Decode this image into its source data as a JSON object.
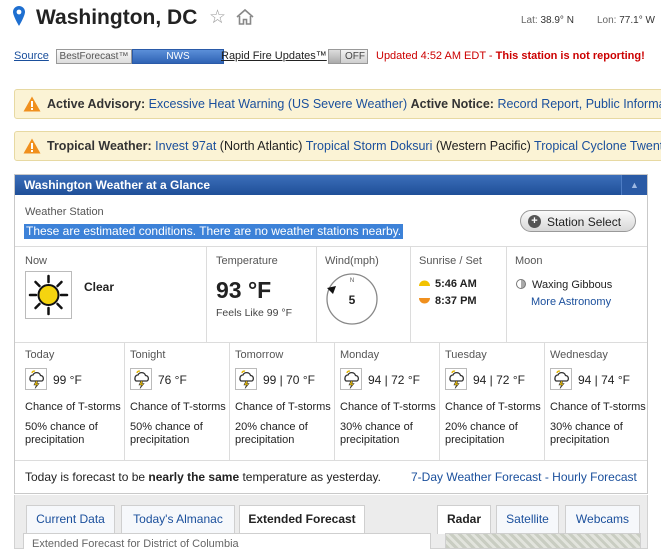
{
  "header": {
    "city": "Washington, DC",
    "lat_label": "Lat:",
    "lat_value": "38.9° N",
    "lon_label": "Lon:",
    "lon_value": "77.1° W"
  },
  "source": {
    "label": "Source",
    "option_best": "BestForecast™",
    "option_nws": "NWS",
    "rapid_fire_label": "Rapid Fire Updates™",
    "rapid_fire_state": "OFF",
    "updated_text": "Updated 4:52 AM EDT",
    "updated_sep": " - ",
    "warning_text": "This station is not reporting!"
  },
  "alerts": {
    "advisory_label": "Active Advisory:",
    "advisory_link": "Excessive Heat Warning (US Severe Weather)",
    "notice_label": "Active Notice:",
    "notice_link1": "Record Report,",
    "notice_link2": "Public Information",
    "tropical_label": "Tropical Weather:",
    "tropical_link1": "Invest 97at",
    "tropical_region1": "(North Atlantic)",
    "tropical_link2": "Tropical Storm Doksuri",
    "tropical_region2": "(Western Pacific)",
    "tropical_link3": "Tropical Cyclone Twentyone"
  },
  "glance": {
    "title": "Washington Weather at a Glance",
    "station_label": "Weather Station",
    "station_note": "These are estimated conditions. There are no weather stations nearby.",
    "station_select": "Station Select"
  },
  "current": {
    "now_label": "Now",
    "condition": "Clear",
    "temp_label": "Temperature",
    "temp_value": "93 °F",
    "feels_like": "Feels Like 99 °F",
    "wind_label": "Wind(mph)",
    "wind_dir": "N",
    "wind_speed": "5",
    "sun_label": "Sunrise / Set",
    "sunrise": "5:46 AM",
    "sunset": "8:37 PM",
    "moon_label": "Moon",
    "moon_phase": "Waxing Gibbous",
    "more_astronomy": "More Astronomy"
  },
  "forecast": [
    {
      "day": "Today",
      "temps": "99 °F",
      "desc": "Chance of T-storms",
      "chance": "50% chance of precipitation"
    },
    {
      "day": "Tonight",
      "temps": "76 °F",
      "desc": "Chance of T-storms",
      "chance": "50% chance of precipitation"
    },
    {
      "day": "Tomorrow",
      "temps": "99 | 70 °F",
      "desc": "Chance of T-storms",
      "chance": "20% chance of precipitation"
    },
    {
      "day": "Monday",
      "temps": "94 | 72 °F",
      "desc": "Chance of T-storms",
      "chance": "30% chance of precipitation"
    },
    {
      "day": "Tuesday",
      "temps": "94 | 72 °F",
      "desc": "Chance of T-storms",
      "chance": "20% chance of precipitation"
    },
    {
      "day": "Wednesday",
      "temps": "94 | 74 °F",
      "desc": "Chance of T-storms",
      "chance": "30% chance of precipitation"
    }
  ],
  "footer": {
    "prefix": "Today is forecast to be ",
    "bold": "nearly the same",
    "suffix": " temperature as yesterday.",
    "link_7day": "7-Day Weather Forecast",
    "sep": " - ",
    "link_hourly": "Hourly Forecast"
  },
  "tabs": {
    "current_data": "Current Data",
    "almanac": "Today's Almanac",
    "extended": "Extended Forecast",
    "radar": "Radar",
    "satellite": "Satellite",
    "webcams": "Webcams",
    "content_peek": "Extended Forecast for District of Columbia"
  },
  "colors": {
    "header_blue": "#1f4f98",
    "link_blue": "#1a4f9c",
    "warning_red": "#cc0000",
    "alert_bg": "#fbf3d5",
    "highlight": "#3d82d8"
  }
}
